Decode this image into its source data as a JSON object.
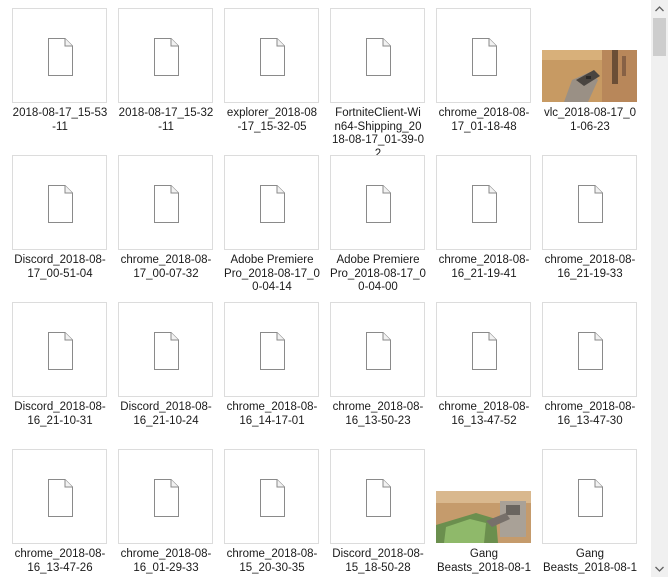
{
  "files": [
    {
      "name": "2018-08-17_15-53-11",
      "type": "doc"
    },
    {
      "name": "2018-08-17_15-32-11",
      "type": "doc"
    },
    {
      "name": "explorer_2018-08-17_15-32-05",
      "type": "doc"
    },
    {
      "name": "FortniteClient-Win64-Shipping_2018-08-17_01-39-02",
      "type": "doc"
    },
    {
      "name": "chrome_2018-08-17_01-18-48",
      "type": "doc"
    },
    {
      "name": "vlc_2018-08-17_01-06-23",
      "type": "photo-vlc"
    },
    {
      "name": "Discord_2018-08-17_00-51-04",
      "type": "doc"
    },
    {
      "name": "chrome_2018-08-17_00-07-32",
      "type": "doc"
    },
    {
      "name": "Adobe Premiere Pro_2018-08-17_00-04-14",
      "type": "doc"
    },
    {
      "name": "Adobe Premiere Pro_2018-08-17_00-04-00",
      "type": "doc"
    },
    {
      "name": "chrome_2018-08-16_21-19-41",
      "type": "doc"
    },
    {
      "name": "chrome_2018-08-16_21-19-33",
      "type": "doc"
    },
    {
      "name": "Discord_2018-08-16_21-10-31",
      "type": "doc"
    },
    {
      "name": "Discord_2018-08-16_21-10-24",
      "type": "doc"
    },
    {
      "name": "chrome_2018-08-16_14-17-01",
      "type": "doc"
    },
    {
      "name": "chrome_2018-08-16_13-50-23",
      "type": "doc"
    },
    {
      "name": "chrome_2018-08-16_13-47-52",
      "type": "doc"
    },
    {
      "name": "chrome_2018-08-16_13-47-30",
      "type": "doc"
    },
    {
      "name": "chrome_2018-08-16_13-47-26",
      "type": "doc"
    },
    {
      "name": "chrome_2018-08-16_01-29-33",
      "type": "doc"
    },
    {
      "name": "chrome_2018-08-15_20-30-35",
      "type": "doc"
    },
    {
      "name": "Discord_2018-08-15_18-50-28",
      "type": "doc"
    },
    {
      "name": "Gang Beasts_2018-08-1",
      "type": "photo-gang"
    },
    {
      "name": "Gang Beasts_2018-08-1",
      "type": "doc"
    }
  ],
  "labels_display": [
    "2018-08-17_15-53\n-11",
    "2018-08-17_15-32\n-11",
    "explorer_2018-08\n-17_15-32-05",
    "FortniteClient-Wi\nn64-Shipping_20\n18-08-17_01-39-0\n2",
    "chrome_2018-08-\n17_01-18-48",
    "vlc_2018-08-17_0\n1-06-23",
    "Discord_2018-08-\n17_00-51-04",
    "chrome_2018-08-\n17_00-07-32",
    "Adobe Premiere\nPro_2018-08-17_0\n0-04-14",
    "Adobe Premiere\nPro_2018-08-17_0\n0-04-00",
    "chrome_2018-08-\n16_21-19-41",
    "chrome_2018-08-\n16_21-19-33",
    "Discord_2018-08-\n16_21-10-31",
    "Discord_2018-08-\n16_21-10-24",
    "chrome_2018-08-\n16_14-17-01",
    "chrome_2018-08-\n16_13-50-23",
    "chrome_2018-08-\n16_13-47-52",
    "chrome_2018-08-\n16_13-47-30",
    "chrome_2018-08-\n16_13-47-26",
    "chrome_2018-08-\n16_01-29-33",
    "chrome_2018-08-\n15_20-30-35",
    "Discord_2018-08-\n15_18-50-28",
    "Gang\nBeasts_2018-08-1",
    "Gang\nBeasts_2018-08-1"
  ],
  "icons": {
    "document": "document-icon",
    "scroll_up": "chevron-up-icon",
    "scroll_down": "chevron-down-icon"
  },
  "colors": {
    "thumb_border": "#dcdcdc",
    "scrollbar_track": "#f0f0f0",
    "scrollbar_thumb": "#cdcdcd",
    "text": "#1a1a1a"
  }
}
